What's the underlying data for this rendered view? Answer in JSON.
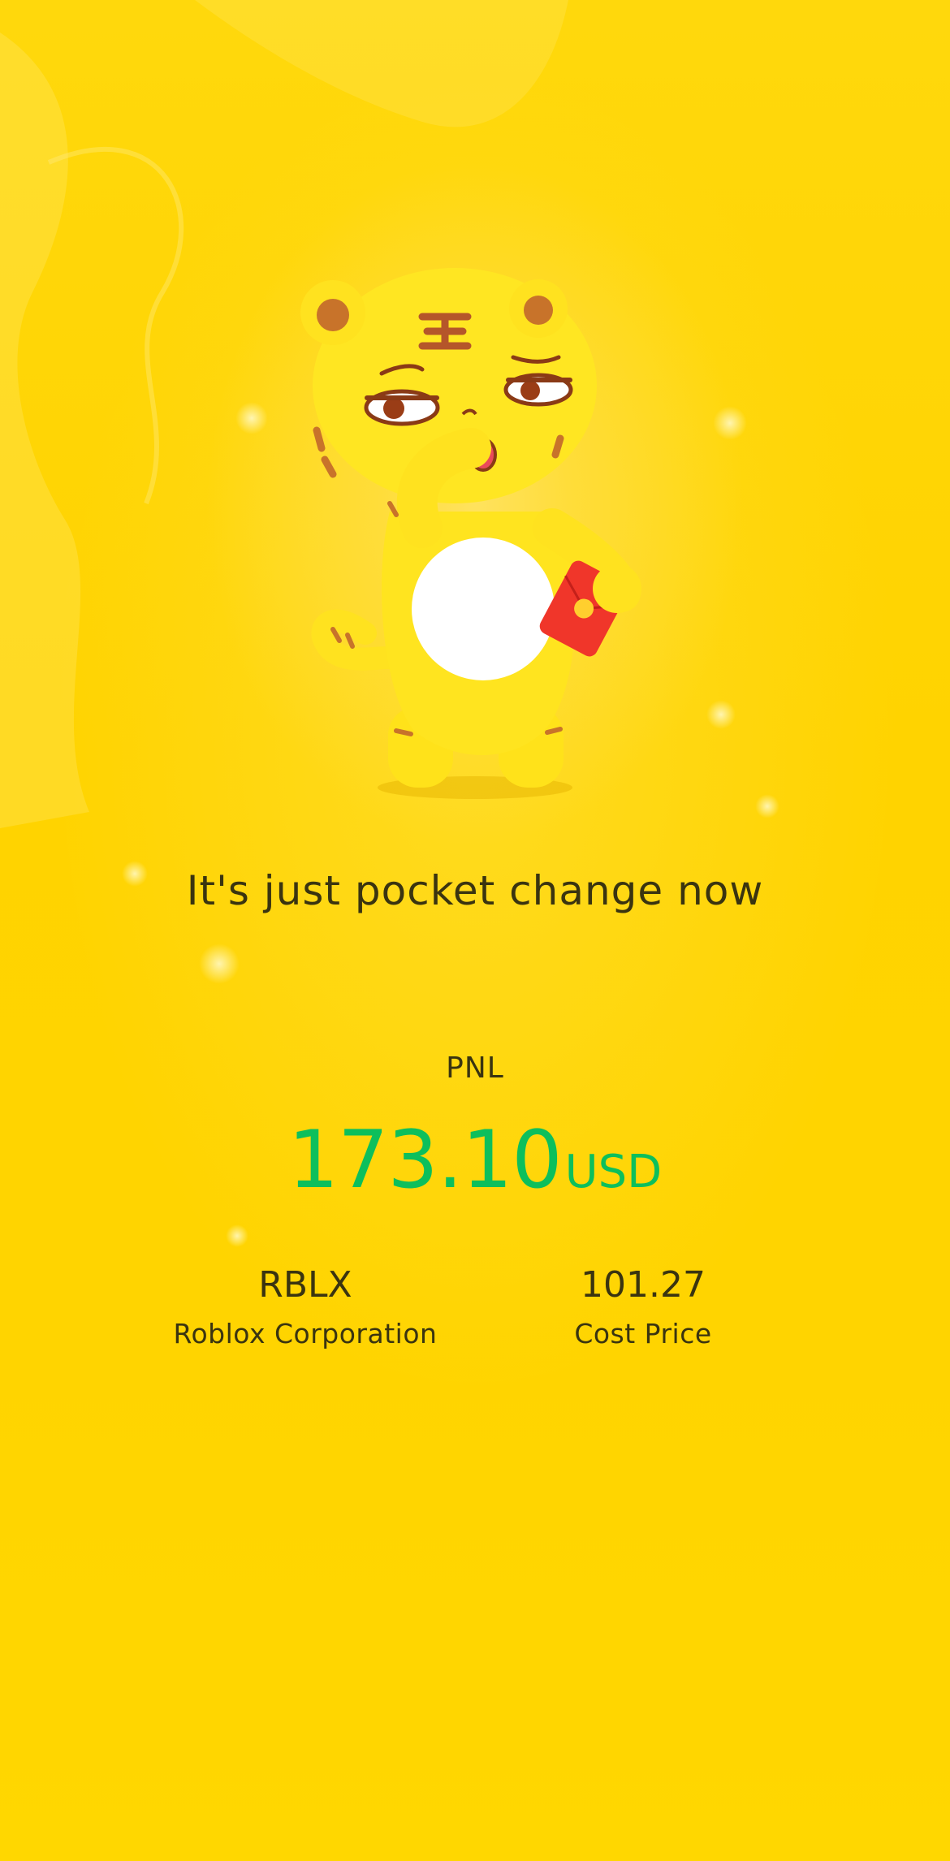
{
  "headline": "It's just pocket change now",
  "pnl": {
    "label": "PNL",
    "value": "173.10",
    "unit": "USD",
    "value_color": "#0DBF5C"
  },
  "stock": {
    "ticker": "RBLX",
    "company": "Roblox Corporation"
  },
  "cost": {
    "value": "101.27",
    "label": "Cost Price"
  },
  "mascot": "tiger-holding-red-envelope",
  "colors": {
    "background": "#FFD400",
    "text": "#3a3410"
  }
}
